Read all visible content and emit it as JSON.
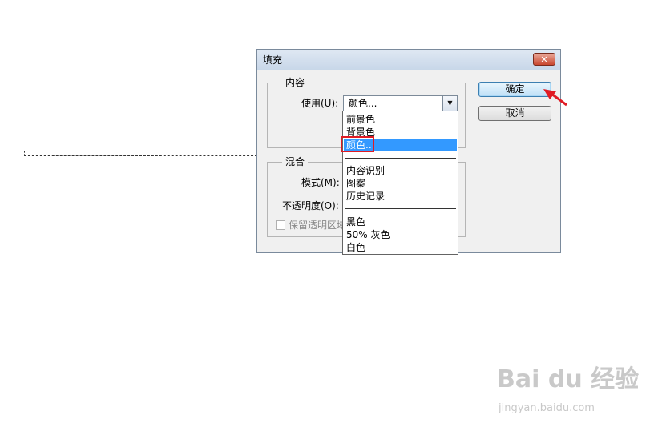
{
  "dialog": {
    "title": "填充",
    "close_label": "✕",
    "buttons": {
      "ok": "确定",
      "cancel": "取消"
    },
    "content": {
      "group_label": "内容",
      "use_label": "使用(U):",
      "use_value": "颜色..."
    },
    "blend": {
      "group_label": "混合",
      "mode_label": "模式(M):",
      "opacity_label": "不透明度(O):",
      "preserve_label": "保留透明区域"
    }
  },
  "dropdown": {
    "options": [
      "前景色",
      "背景色",
      "颜色..",
      "内容识别",
      "图案",
      "历史记录",
      "黑色",
      "50% 灰色",
      "白色"
    ],
    "selected_index": 2
  },
  "icons": {
    "arrow": "red-arrow-icon",
    "dropdown": "chevron-down-icon"
  },
  "colors": {
    "selection": "#3399ff",
    "highlight": "#e01b24"
  },
  "watermark": {
    "brand": "Bai du 经验",
    "url": "jingyan.baidu.com"
  }
}
